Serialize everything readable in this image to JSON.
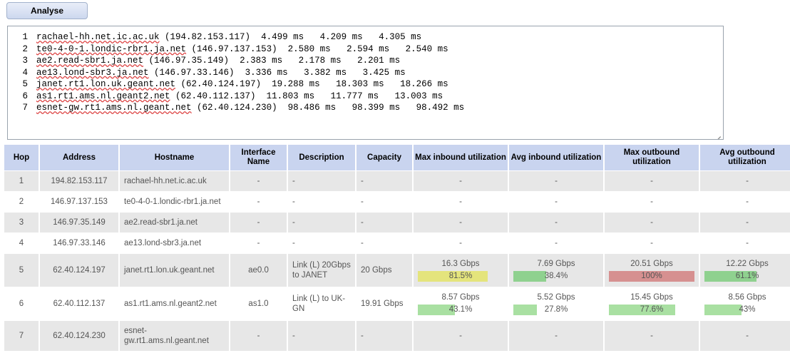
{
  "toolbar": {
    "analyse_label": "Analyse"
  },
  "traceroute": {
    "lines": [
      {
        "num": "1",
        "host": "rachael-hh.net.ic.ac.uk",
        "ip": "(194.82.153.117)",
        "rtts": "4.499 ms   4.209 ms   4.305 ms"
      },
      {
        "num": "2",
        "host": "te0-4-0-1.londic-rbr1.ja.net",
        "ip": "(146.97.137.153)",
        "rtts": "2.580 ms   2.594 ms   2.540 ms"
      },
      {
        "num": "3",
        "host": "ae2.read-sbr1.ja.net",
        "ip": "(146.97.35.149)",
        "rtts": "2.383 ms   2.178 ms   2.201 ms"
      },
      {
        "num": "4",
        "host": "ae13.lond-sbr3.ja.net",
        "ip": "(146.97.33.146)",
        "rtts": "3.336 ms   3.382 ms   3.425 ms"
      },
      {
        "num": "5",
        "host": "janet.rt1.lon.uk.geant.net",
        "ip": "(62.40.124.197)",
        "rtts": "19.288 ms   18.303 ms   18.266 ms"
      },
      {
        "num": "6",
        "host": "as1.rt1.ams.nl.geant2.net",
        "ip": "(62.40.112.137)",
        "rtts": "11.803 ms   11.777 ms   13.003 ms"
      },
      {
        "num": "7",
        "host": "esnet-gw.rt1.ams.nl.geant.net",
        "ip": "(62.40.124.230)",
        "rtts": "98.486 ms   98.399 ms   98.492 ms"
      }
    ]
  },
  "table": {
    "columns": [
      "Hop",
      "Address",
      "Hostname",
      "Interface Name",
      "Description",
      "Capacity",
      "Max inbound utilization",
      "Avg inbound utilization",
      "Max outbound utilization",
      "Avg outbound utilization"
    ],
    "rows": [
      {
        "hop": "1",
        "address": "194.82.153.117",
        "hostname": "rachael-hh.net.ic.ac.uk",
        "interface": "-",
        "description": "-",
        "capacity": "-",
        "max_in": {
          "rate": "-",
          "pct_label": "",
          "pct": 0,
          "color": ""
        },
        "avg_in": {
          "rate": "-",
          "pct_label": "",
          "pct": 0,
          "color": ""
        },
        "max_out": {
          "rate": "-",
          "pct_label": "",
          "pct": 0,
          "color": ""
        },
        "avg_out": {
          "rate": "-",
          "pct_label": "",
          "pct": 0,
          "color": ""
        }
      },
      {
        "hop": "2",
        "address": "146.97.137.153",
        "hostname": "te0-4-0-1.londic-rbr1.ja.net",
        "interface": "-",
        "description": "-",
        "capacity": "-",
        "max_in": {
          "rate": "-",
          "pct_label": "",
          "pct": 0,
          "color": ""
        },
        "avg_in": {
          "rate": "-",
          "pct_label": "",
          "pct": 0,
          "color": ""
        },
        "max_out": {
          "rate": "-",
          "pct_label": "",
          "pct": 0,
          "color": ""
        },
        "avg_out": {
          "rate": "-",
          "pct_label": "",
          "pct": 0,
          "color": ""
        }
      },
      {
        "hop": "3",
        "address": "146.97.35.149",
        "hostname": "ae2.read-sbr1.ja.net",
        "interface": "-",
        "description": "-",
        "capacity": "-",
        "max_in": {
          "rate": "-",
          "pct_label": "",
          "pct": 0,
          "color": ""
        },
        "avg_in": {
          "rate": "-",
          "pct_label": "",
          "pct": 0,
          "color": ""
        },
        "max_out": {
          "rate": "-",
          "pct_label": "",
          "pct": 0,
          "color": ""
        },
        "avg_out": {
          "rate": "-",
          "pct_label": "",
          "pct": 0,
          "color": ""
        }
      },
      {
        "hop": "4",
        "address": "146.97.33.146",
        "hostname": "ae13.lond-sbr3.ja.net",
        "interface": "-",
        "description": "-",
        "capacity": "-",
        "max_in": {
          "rate": "-",
          "pct_label": "",
          "pct": 0,
          "color": ""
        },
        "avg_in": {
          "rate": "-",
          "pct_label": "",
          "pct": 0,
          "color": ""
        },
        "max_out": {
          "rate": "-",
          "pct_label": "",
          "pct": 0,
          "color": ""
        },
        "avg_out": {
          "rate": "-",
          "pct_label": "",
          "pct": 0,
          "color": ""
        }
      },
      {
        "hop": "5",
        "address": "62.40.124.197",
        "hostname": "janet.rt1.lon.uk.geant.net",
        "interface": "ae0.0",
        "description": "Link (L) 20Gbps to JANET",
        "capacity": "20 Gbps",
        "max_in": {
          "rate": "16.3 Gbps",
          "pct_label": "81.5%",
          "pct": 81.5,
          "color": "#e4e47c"
        },
        "avg_in": {
          "rate": "7.69 Gbps",
          "pct_label": "38.4%",
          "pct": 38.4,
          "color": "#8fd18f"
        },
        "max_out": {
          "rate": "20.51 Gbps",
          "pct_label": "100%",
          "pct": 100,
          "color": "#d69090"
        },
        "avg_out": {
          "rate": "12.22 Gbps",
          "pct_label": "61.1%",
          "pct": 61.1,
          "color": "#8fd18f"
        }
      },
      {
        "hop": "6",
        "address": "62.40.112.137",
        "hostname": "as1.rt1.ams.nl.geant2.net",
        "interface": "as1.0",
        "description": "Link (L) to UK-GN",
        "capacity": "19.91 Gbps",
        "max_in": {
          "rate": "8.57 Gbps",
          "pct_label": "43.1%",
          "pct": 43.1,
          "color": "#a9e0a2"
        },
        "avg_in": {
          "rate": "5.52 Gbps",
          "pct_label": "27.8%",
          "pct": 27.8,
          "color": "#a9e0a2"
        },
        "max_out": {
          "rate": "15.45 Gbps",
          "pct_label": "77.6%",
          "pct": 77.6,
          "color": "#a9e0a2"
        },
        "avg_out": {
          "rate": "8.56 Gbps",
          "pct_label": "43%",
          "pct": 43,
          "color": "#a9e0a2"
        }
      },
      {
        "hop": "7",
        "address": "62.40.124.230",
        "hostname": "esnet-gw.rt1.ams.nl.geant.net",
        "interface": "-",
        "description": "-",
        "capacity": "-",
        "max_in": {
          "rate": "-",
          "pct_label": "",
          "pct": 0,
          "color": ""
        },
        "avg_in": {
          "rate": "-",
          "pct_label": "",
          "pct": 0,
          "color": ""
        },
        "max_out": {
          "rate": "-",
          "pct_label": "",
          "pct": 0,
          "color": ""
        },
        "avg_out": {
          "rate": "-",
          "pct_label": "",
          "pct": 0,
          "color": ""
        }
      }
    ]
  },
  "colors": {
    "header_bg": "#c9d4ef",
    "row_odd_bg": "#e7e7e7",
    "row_even_bg": "#ffffff",
    "bar_green": "#a9e0a2",
    "bar_yellow": "#e4e47c",
    "bar_red": "#d69090"
  }
}
